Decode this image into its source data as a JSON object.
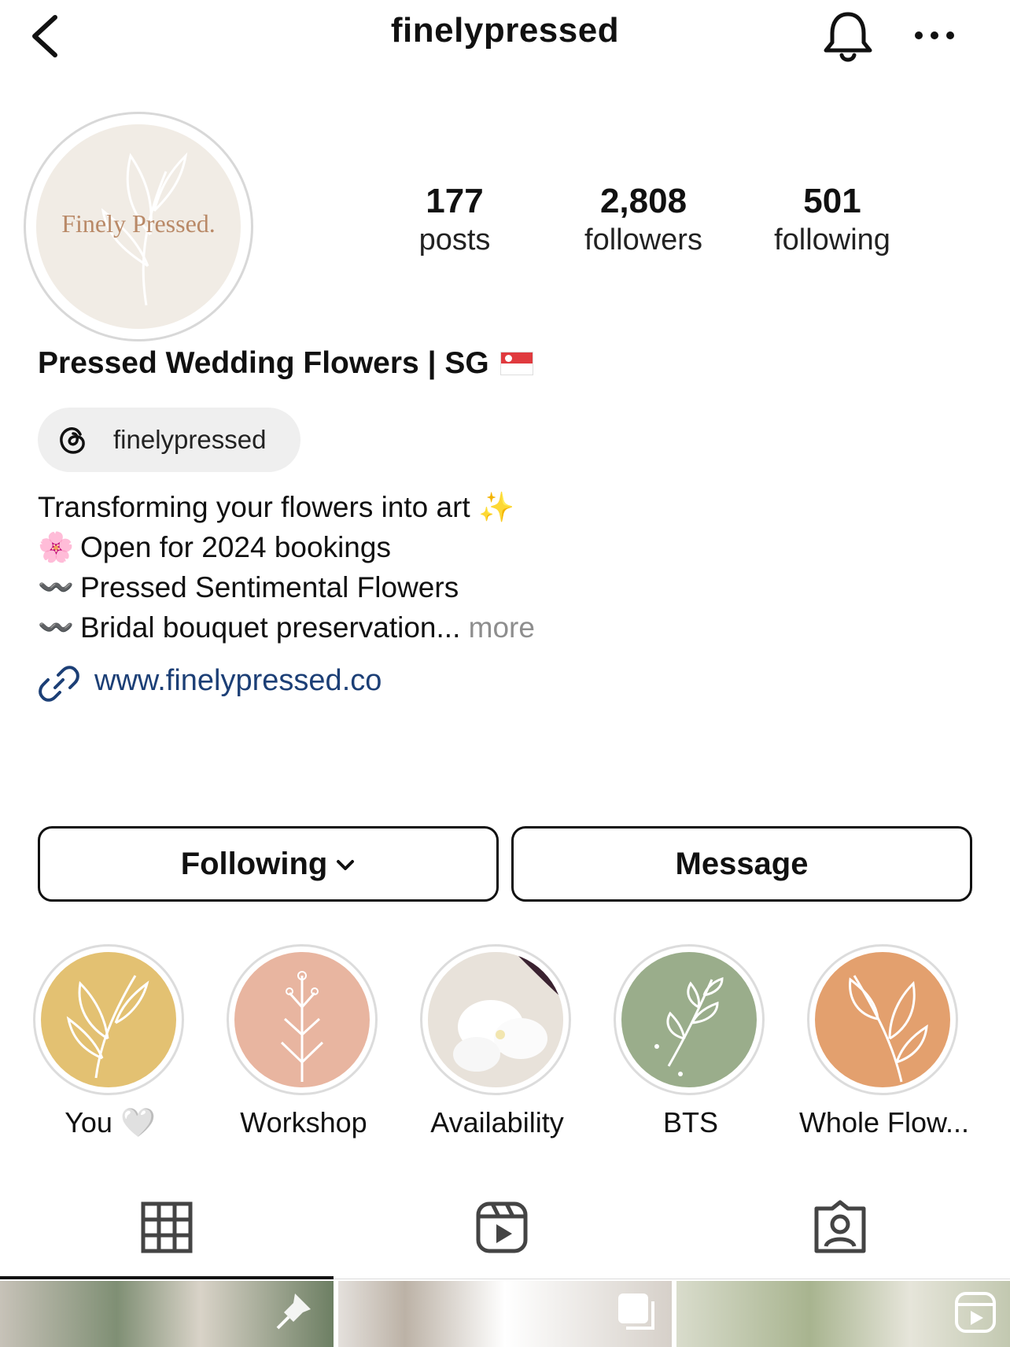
{
  "header": {
    "username": "finelypressed",
    "back_icon": "chevron-left-icon",
    "bell_icon": "bell-icon",
    "more_icon": "more-dots-icon"
  },
  "profile": {
    "avatar_text": "Finely Pressed.",
    "stats": [
      {
        "value": "177",
        "label": "posts"
      },
      {
        "value": "2,808",
        "label": "followers"
      },
      {
        "value": "501",
        "label": "following"
      }
    ],
    "name": "Pressed Wedding Flowers | SG",
    "threads_handle": "finelypressed",
    "bio": {
      "line1": "Transforming your flowers into art",
      "line1_emoji": "✨",
      "line2_emoji": "🌸",
      "line2": "Open for 2024 bookings",
      "line3_emoji": "〰️",
      "line3": "Pressed Sentimental Flowers",
      "line4_emoji": "〰️",
      "line4": "Bridal bouquet preservation...",
      "more": "more"
    },
    "website": "www.finelypressed.co"
  },
  "actions": {
    "following": "Following",
    "message": "Message"
  },
  "highlights": [
    {
      "label": "You 🤍",
      "color": "#e3c172"
    },
    {
      "label": "Workshop",
      "color": "#e8b5a0"
    },
    {
      "label": "Availability",
      "color": "#eeeae6"
    },
    {
      "label": "BTS",
      "color": "#9aad8b"
    },
    {
      "label": "Whole Flow...",
      "color": "#e3a06e"
    }
  ],
  "tabs": [
    {
      "name": "grid-icon"
    },
    {
      "name": "reels-icon"
    },
    {
      "name": "tagged-icon"
    }
  ]
}
